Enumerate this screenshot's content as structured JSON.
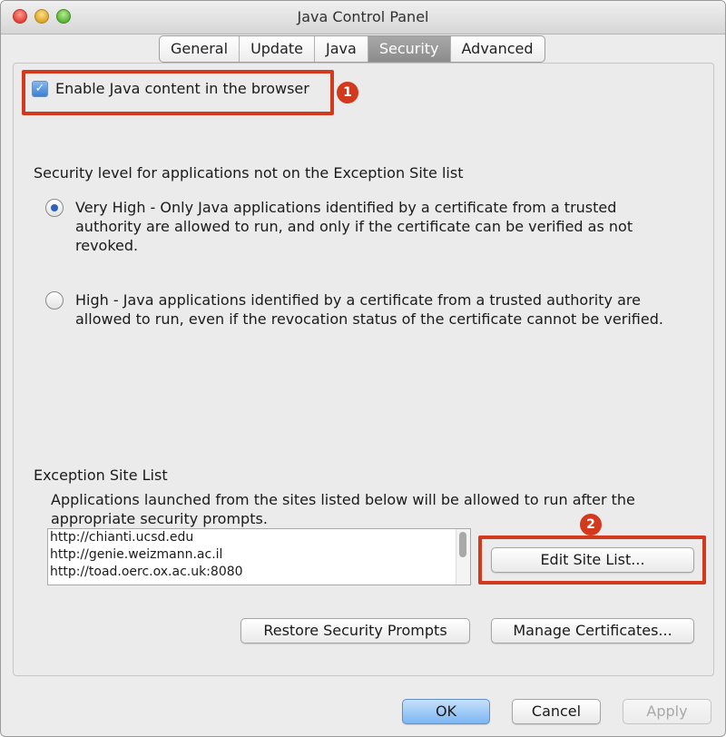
{
  "window": {
    "title": "Java Control Panel"
  },
  "tabs": [
    {
      "label": "General"
    },
    {
      "label": "Update"
    },
    {
      "label": "Java"
    },
    {
      "label": "Security"
    },
    {
      "label": "Advanced"
    }
  ],
  "active_tab": "Security",
  "enable_java": {
    "label": "Enable Java content in the browser",
    "checked": true
  },
  "markers": {
    "one": "1",
    "two": "2"
  },
  "security_level": {
    "heading": "Security level for applications not on the Exception Site list",
    "options": [
      {
        "text": "Very High - Only Java applications identified by a certificate from a trusted authority are allowed to run, and only if the certificate can be verified as not revoked.",
        "selected": true
      },
      {
        "text": "High - Java applications identified by a certificate from a trusted authority are allowed to run, even if the revocation status of the certificate cannot be verified.",
        "selected": false
      }
    ]
  },
  "exception_list": {
    "heading": "Exception Site List",
    "description": "Applications launched from the sites listed below will be allowed to run after the appropriate security prompts.",
    "sites": [
      "http://chianti.ucsd.edu",
      "http://genie.weizmann.ac.il",
      "http://toad.oerc.ox.ac.uk:8080"
    ],
    "edit_button": "Edit Site List..."
  },
  "buttons": {
    "restore": "Restore Security Prompts",
    "manage": "Manage Certificates...",
    "ok": "OK",
    "cancel": "Cancel",
    "apply": "Apply"
  },
  "colors": {
    "highlight": "#d3391c",
    "selected_tab": "#999999",
    "primary_button": "#7cb6f2"
  }
}
